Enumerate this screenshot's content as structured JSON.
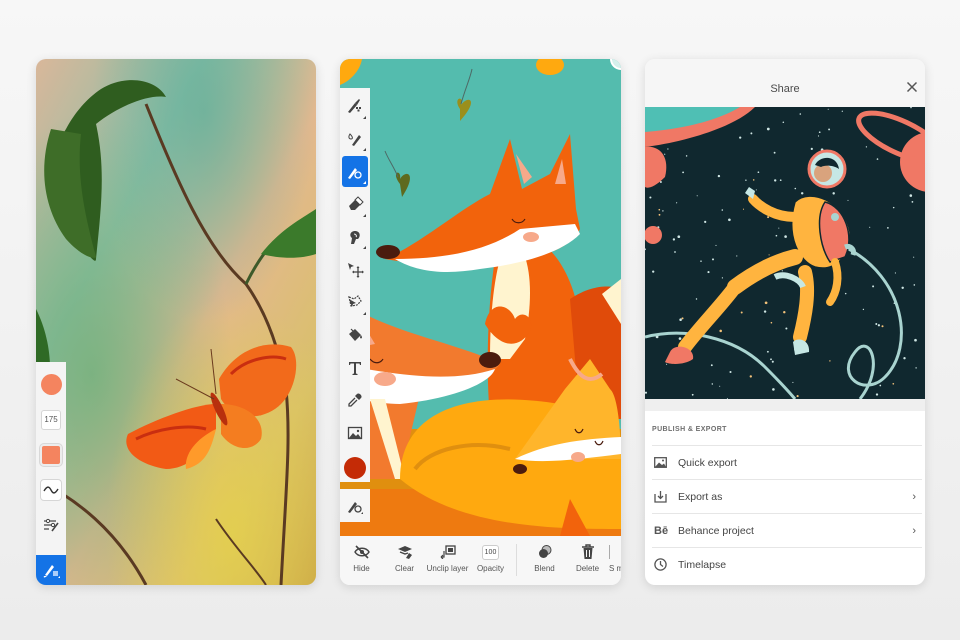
{
  "panel_watercolor": {
    "toolbar": {
      "brush_size_value": "175",
      "primary_color": "#f4845f",
      "active_tool_color": "#1473e6"
    }
  },
  "panel_foxes": {
    "toolbar": {
      "selected_color": "#c42b06",
      "active_tool_color": "#1473e6"
    },
    "bottom_bar": {
      "hide_label": "Hide",
      "clear_label": "Clear",
      "unclip_label": "Unclip layer",
      "opacity_label": "Opacity",
      "opacity_value": "100",
      "blend_label": "Blend",
      "delete_label": "Delete",
      "more_label": "S m"
    }
  },
  "panel_share": {
    "title": "Share",
    "section_label": "PUBLISH & EXPORT",
    "menu": [
      {
        "label": "Quick export",
        "icon": "image-icon",
        "has_chevron": false
      },
      {
        "label": "Export as",
        "icon": "download-tray-icon",
        "has_chevron": true
      },
      {
        "label": "Behance project",
        "icon": "behance-icon",
        "icon_text": "Bē",
        "has_chevron": true
      },
      {
        "label": "Timelapse",
        "icon": "clock-icon",
        "has_chevron": false
      }
    ],
    "chevron_glyph": "›"
  }
}
